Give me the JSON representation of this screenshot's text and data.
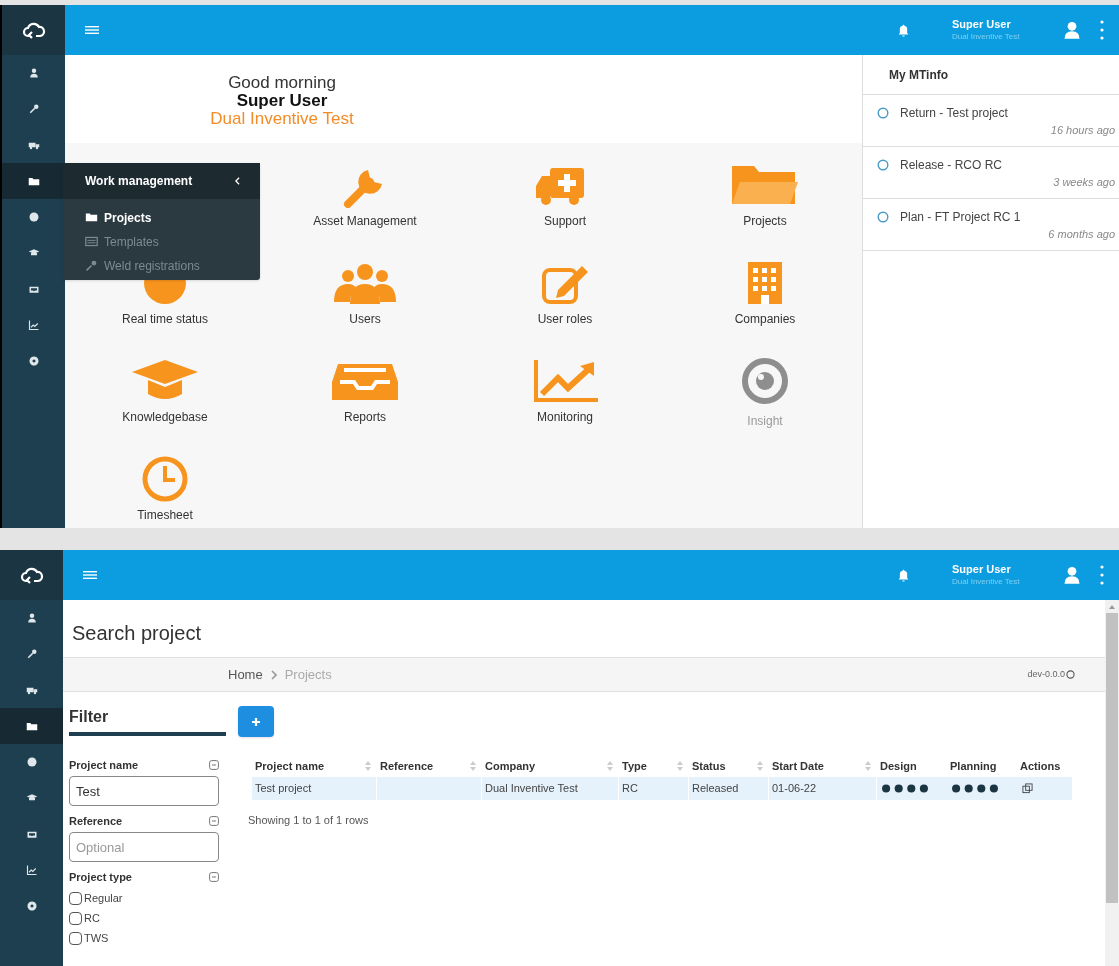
{
  "dashboard_window": {
    "header": {
      "user_name": "Super User",
      "company": "Dual Inventive Test"
    },
    "sidebar": {
      "items": [
        {
          "selected": false
        },
        {
          "selected": false
        },
        {
          "selected": false
        },
        {
          "selected": true
        },
        {
          "selected": false
        },
        {
          "selected": false
        },
        {
          "selected": false
        },
        {
          "selected": false
        },
        {
          "selected": false
        }
      ]
    },
    "flyout_menu": {
      "title": "Work management",
      "items": [
        {
          "label": "Projects",
          "selected": true
        },
        {
          "label": "Templates",
          "selected": false
        },
        {
          "label": "Weld registrations",
          "selected": false
        }
      ]
    },
    "greeting": {
      "salutation": "Good morning",
      "name": "Super User",
      "company": "Dual Inventive Test"
    },
    "tiles": [
      {
        "label": "Asset Management",
        "disabled": false
      },
      {
        "label": "Support",
        "disabled": false
      },
      {
        "label": "Projects",
        "disabled": false
      },
      {
        "label": "Real time status",
        "disabled": false
      },
      {
        "label": "Users",
        "disabled": false
      },
      {
        "label": "User roles",
        "disabled": false
      },
      {
        "label": "Companies",
        "disabled": false
      },
      {
        "label": "Knowledgebase",
        "disabled": false
      },
      {
        "label": "Reports",
        "disabled": false
      },
      {
        "label": "Monitoring",
        "disabled": false
      },
      {
        "label": "Insight",
        "disabled": true
      },
      {
        "label": "Timesheet",
        "disabled": false
      }
    ],
    "my_mtinfo": {
      "title": "My MTinfo",
      "items": [
        {
          "text": "Return - Test project",
          "time": "16 hours ago"
        },
        {
          "text": "Release - RCO RC",
          "time": "3 weeks ago"
        },
        {
          "text": "Plan - FT Project RC 1",
          "time": "6 months ago"
        }
      ]
    }
  },
  "projects_window": {
    "header": {
      "user_name": "Super User",
      "company": "Dual Inventive Test"
    },
    "sidebar": {
      "items": [
        {
          "selected": false
        },
        {
          "selected": false
        },
        {
          "selected": false
        },
        {
          "selected": true
        },
        {
          "selected": false
        },
        {
          "selected": false
        },
        {
          "selected": false
        },
        {
          "selected": false
        },
        {
          "selected": false
        }
      ]
    },
    "title": "Search project",
    "breadcrumb": [
      {
        "label": "Home",
        "current": false
      },
      {
        "label": "Projects",
        "current": true
      }
    ],
    "version": "dev-0.0.0",
    "filter": {
      "title": "Filter",
      "fields": [
        {
          "kind": "text",
          "label": "Project name",
          "value": "Test"
        },
        {
          "kind": "text",
          "label": "Reference",
          "placeholder": "Optional"
        },
        {
          "kind": "checkboxes",
          "label": "Project type",
          "options": [
            {
              "label": "Regular",
              "checked": false
            },
            {
              "label": "RC",
              "checked": false
            },
            {
              "label": "TWS",
              "checked": false
            }
          ]
        }
      ]
    },
    "table": {
      "columns": [
        {
          "label": "Project name",
          "sortable": true
        },
        {
          "label": "Reference",
          "sortable": true
        },
        {
          "label": "Company",
          "sortable": true
        },
        {
          "label": "Type",
          "sortable": true
        },
        {
          "label": "Status",
          "sortable": true
        },
        {
          "label": "Start Date",
          "sortable": true
        },
        {
          "label": "Design",
          "sortable": false
        },
        {
          "label": "Planning",
          "sortable": false
        },
        {
          "label": "Actions",
          "sortable": false
        }
      ],
      "rows": [
        {
          "project_name": "Test project",
          "company": "Dual Inventive Test",
          "type": "RC",
          "status": "Released",
          "start_date": "01-06-22",
          "selected": true
        }
      ],
      "footer": "Showing 1 to 1 of 1 rows"
    }
  }
}
